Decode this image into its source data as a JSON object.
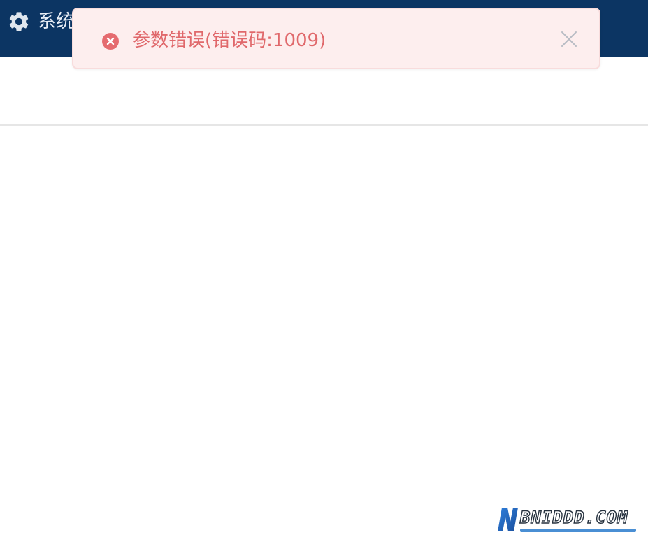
{
  "header": {
    "title": "系统",
    "icon": "gear-icon",
    "background_color": "#0c3563"
  },
  "toast": {
    "type": "error",
    "icon": "error-circle-icon",
    "message": "参数错误(错误码:1009)",
    "close_icon": "close-icon",
    "colors": {
      "background": "#fdeeee",
      "text": "#e0686b",
      "icon": "#e56b6f"
    }
  },
  "watermark": {
    "logo_letter": "N",
    "text": "BNIDDD.COM"
  }
}
